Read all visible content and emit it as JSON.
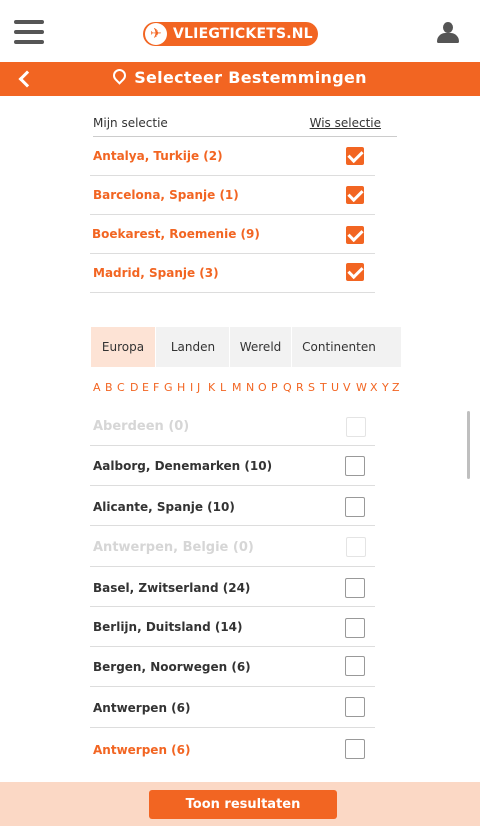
{
  "header": {
    "logo_text": "VLIEGTICKETS.NL",
    "title": "Selecteer Bestemmingen"
  },
  "selection": {
    "label": "Mijn selectie",
    "clear_label": "Wis selectie",
    "items": [
      {
        "label": "Antalya, Turkije (2)",
        "checked": true
      },
      {
        "label": "Barcelona, Spanje (1)",
        "checked": true
      },
      {
        "label": "Boekarest, Roemenie (9)",
        "checked": true
      },
      {
        "label": "Madrid, Spanje (3)",
        "checked": true
      }
    ]
  },
  "tabs": [
    {
      "label": "Europa",
      "active": true
    },
    {
      "label": "Landen",
      "active": false
    },
    {
      "label": "Wereld",
      "active": false
    },
    {
      "label": "Continenten",
      "active": false
    }
  ],
  "alphabet": [
    "A",
    "B",
    "C",
    "D",
    "E",
    "F",
    "G",
    "H",
    "I",
    "J",
    "K",
    "L",
    "M",
    "N",
    "O",
    "P",
    "Q",
    "R",
    "S",
    "T",
    "U",
    "V",
    "W",
    "X",
    "Y",
    "Z"
  ],
  "destinations": [
    {
      "label": "Aberdeen (0)",
      "state": "disabled"
    },
    {
      "label": "Aalborg, Denemarken (10)",
      "state": "unchecked"
    },
    {
      "label": "Alicante, Spanje (10)",
      "state": "unchecked"
    },
    {
      "label": "Antwerpen, Belgie (0)",
      "state": "disabled"
    },
    {
      "label": "Basel, Zwitserland (24)",
      "state": "unchecked"
    },
    {
      "label": "Berlijn, Duitsland (14)",
      "state": "unchecked"
    },
    {
      "label": "Bergen, Noorwegen (6)",
      "state": "unchecked"
    },
    {
      "label": "Antwerpen (6)",
      "state": "unchecked"
    },
    {
      "label": "Antwerpen (6)",
      "state": "unchecked",
      "highlight": true
    }
  ],
  "footer": {
    "button_label": "Toon resultaten"
  },
  "colors": {
    "accent": "#f26522",
    "tab_active_bg": "#fde3d5",
    "footer_bg": "#fbd8c5"
  }
}
